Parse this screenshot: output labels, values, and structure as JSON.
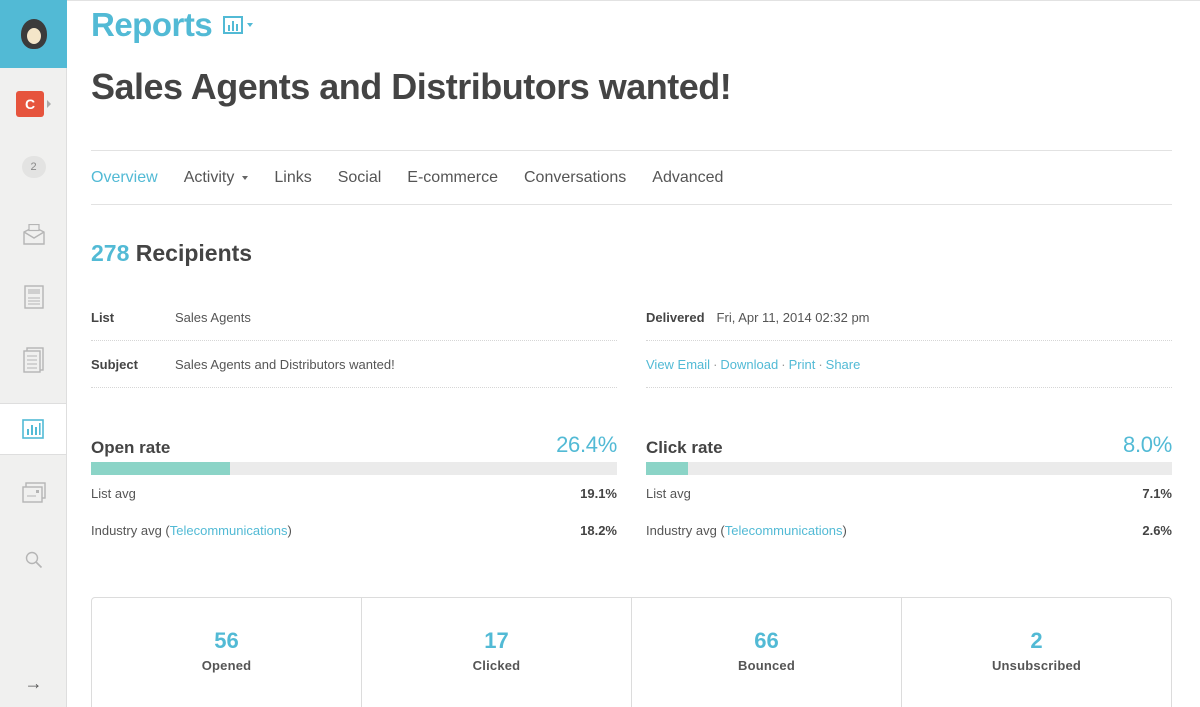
{
  "sidebar": {
    "account_letter": "C",
    "notification_count": "2",
    "collapse_arrow": "→",
    "icons": [
      "campaigns-icon",
      "templates-icon",
      "lists-icon",
      "reports-icon",
      "automation-icon",
      "search-icon"
    ]
  },
  "header": {
    "section_title": "Reports",
    "campaign_title": "Sales Agents and Distributors wanted!"
  },
  "tabs": [
    {
      "label": "Overview",
      "active": true
    },
    {
      "label": "Activity",
      "dropdown": true
    },
    {
      "label": "Links"
    },
    {
      "label": "Social"
    },
    {
      "label": "E-commerce"
    },
    {
      "label": "Conversations"
    },
    {
      "label": "Advanced"
    }
  ],
  "recipients": {
    "count": "278",
    "label": "Recipients"
  },
  "details": {
    "list_label": "List",
    "list_value": "Sales Agents",
    "subject_label": "Subject",
    "subject_value": "Sales Agents and Distributors wanted!",
    "delivered_label": "Delivered",
    "delivered_value": "Fri, Apr 11, 2014 02:32 pm",
    "actions": [
      "View Email",
      "Download",
      "Print",
      "Share"
    ],
    "action_separator": "·"
  },
  "open_rate": {
    "label": "Open rate",
    "value": "26.4%",
    "fill_percent": 26.4,
    "list_avg_label": "List avg",
    "list_avg": "19.1%",
    "industry_avg_prefix": "Industry avg (",
    "industry_link": "Telecommunications",
    "industry_avg_suffix": ")",
    "industry_avg": "18.2%"
  },
  "click_rate": {
    "label": "Click rate",
    "value": "8.0%",
    "fill_percent": 8.0,
    "list_avg_label": "List avg",
    "list_avg": "7.1%",
    "industry_avg_prefix": "Industry avg (",
    "industry_link": "Telecommunications",
    "industry_avg_suffix": ")",
    "industry_avg": "2.6%"
  },
  "stats": [
    {
      "value": "56",
      "label": "Opened"
    },
    {
      "value": "17",
      "label": "Clicked"
    },
    {
      "value": "66",
      "label": "Bounced"
    },
    {
      "value": "2",
      "label": "Unsubscribed"
    }
  ],
  "colors": {
    "accent": "#52bad5",
    "bar_fill": "#8bd4c7",
    "account_badge": "#e6543d"
  }
}
